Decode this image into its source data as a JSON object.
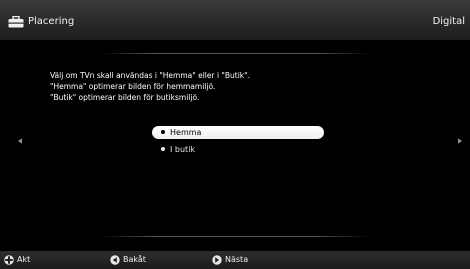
{
  "header": {
    "title": "Placering",
    "source": "Digital",
    "icon": "briefcase-icon"
  },
  "description": {
    "lines": [
      "Välj om TVn skall användas i \"Hemma\" eller i \"Butik\".",
      "\"Hemma\" optimerar bilden för hemmamiljö.",
      "\"Butik\" optimerar bilden för butiksmiljö."
    ]
  },
  "options": [
    {
      "label": "Hemma",
      "selected": true
    },
    {
      "label": "I butik",
      "selected": false
    }
  ],
  "footer": {
    "act_label": "Akt",
    "back_label": "Bakåt",
    "next_label": "Nästa"
  },
  "colors": {
    "background": "#000000",
    "header_bar": "#2a2a2a",
    "highlight": "#ffffff",
    "text": "#ffffff"
  }
}
